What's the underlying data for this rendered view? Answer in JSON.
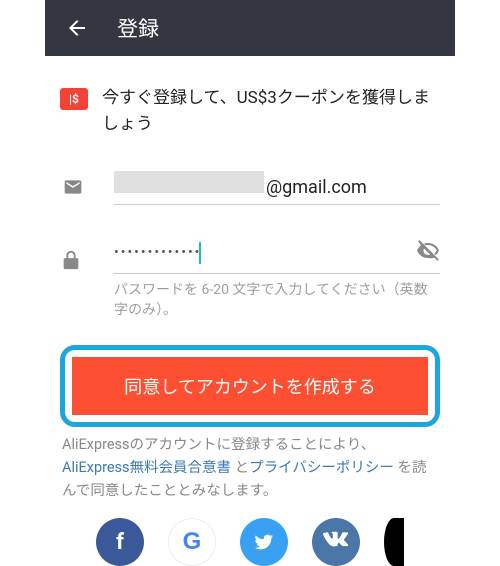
{
  "header": {
    "title": "登録"
  },
  "promo": {
    "text": "今すぐ登録して、US$3クーポンを獲得しましょう"
  },
  "email": {
    "suffix": "@gmail.com"
  },
  "password": {
    "masked": "•••••••••••••",
    "hint": "パスワードを 6-20 文字で入力してください（英数字のみ）。"
  },
  "cta": {
    "label": "同意してアカウントを作成する"
  },
  "legal": {
    "prefix": "AliExpressのアカウントに登録することにより、",
    "link1": "AliExpress無料会員合意書",
    "mid": " と",
    "link2": "プライバシーポリシー",
    "suffix": "を読んで同意したこととみなします。"
  }
}
